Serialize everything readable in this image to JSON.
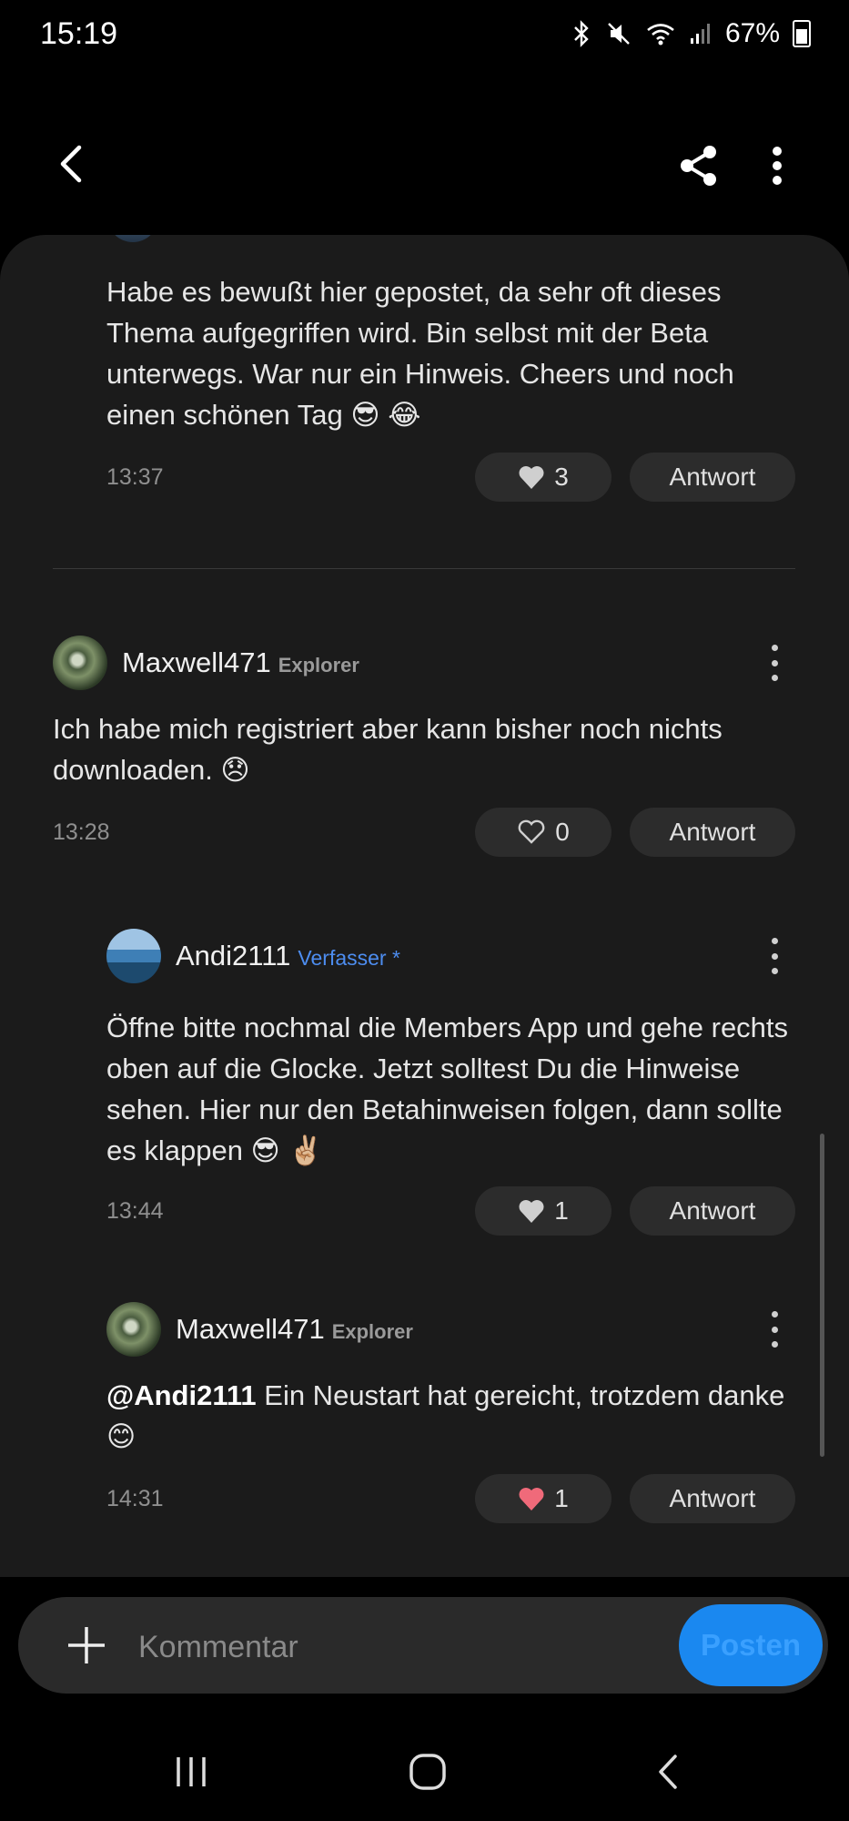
{
  "status_bar": {
    "time": "15:19",
    "battery": "67%"
  },
  "comments": [
    {
      "text": "Habe es bewußt hier gepostet, da sehr oft dieses Thema aufgegriffen wird. Bin selbst mit der Beta unterwegs. War nur ein Hinweis. Cheers und noch einen schönen Tag 😎 😂",
      "time": "13:37",
      "likes": "3",
      "reply_label": "Antwort"
    },
    {
      "username": "Maxwell471",
      "rank": "Explorer",
      "text": "Ich habe mich registriert aber kann bisher noch nichts downloaden. 😞",
      "time": "13:28",
      "likes": "0",
      "reply_label": "Antwort"
    },
    {
      "username": "Andi2111",
      "rank": "Verfasser *",
      "text": "Öffne bitte nochmal die Members App und gehe rechts oben auf die Glocke. Jetzt solltest Du die Hinweise sehen. Hier nur den Betahinweisen folgen, dann sollte es klappen 😎 ✌🏼",
      "time": "13:44",
      "likes": "1",
      "reply_label": "Antwort"
    },
    {
      "username": "Maxwell471",
      "rank": "Explorer",
      "mention": "@Andi2111",
      "text": " Ein Neustart hat gereicht, trotzdem danke 😊",
      "time": "14:31",
      "likes": "1",
      "reply_label": "Antwort"
    }
  ],
  "composer": {
    "placeholder": "Kommentar",
    "post_label": "Posten"
  },
  "colors": {
    "accent": "#1a88f0",
    "author_rank": "#4d8df0",
    "liked_heart": "#f06a7a"
  }
}
